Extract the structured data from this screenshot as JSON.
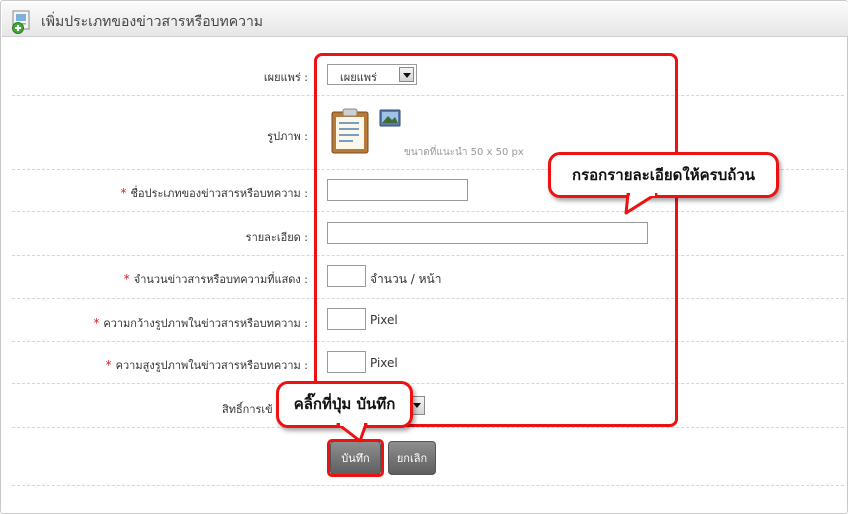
{
  "header": {
    "title": "เพิ่มประเภทของข่าวสารหรือบทความ",
    "icon": "add-document-icon"
  },
  "form": {
    "publish": {
      "label": "เผยแพร่ :",
      "value": "เผยแพร่"
    },
    "image": {
      "label": "รูปภาพ :",
      "hint": "ขนาดที่แนะนำ 50 x 50 px",
      "icon": "clipboard-icon",
      "select_icon": "image-picker-icon"
    },
    "name": {
      "label": "ชื่อประเภทของข่าวสารหรือบทความ :",
      "required_mark": "*",
      "value": ""
    },
    "detail": {
      "label": "รายละเอียด :",
      "value": ""
    },
    "count": {
      "label": "จำนวนข่าวสารหรือบทความที่แสดง :",
      "required_mark": "*",
      "value": "",
      "suffix": "จำนวน / หน้า"
    },
    "width": {
      "label": "ความกว้างรูปภาพในข่าวสารหรือบทความ :",
      "required_mark": "*",
      "value": "",
      "suffix": "Pixel"
    },
    "height": {
      "label": "ความสูงรูปภาพในข่าวสารหรือบทความ :",
      "required_mark": "*",
      "value": "",
      "suffix": "Pixel"
    },
    "access": {
      "label": "สิทธิ์การเข้"
    }
  },
  "buttons": {
    "save": "บันทึก",
    "cancel": "ยกเลิก"
  },
  "callouts": {
    "fill_details": "กรอกรายละเอียดให้ครบถ้วน",
    "click_save": "คลิ๊กที่ปุ่ม บันทึก"
  },
  "colors": {
    "highlight": "#ee1111",
    "required": "#d62020",
    "button": "#6f6f6f"
  }
}
